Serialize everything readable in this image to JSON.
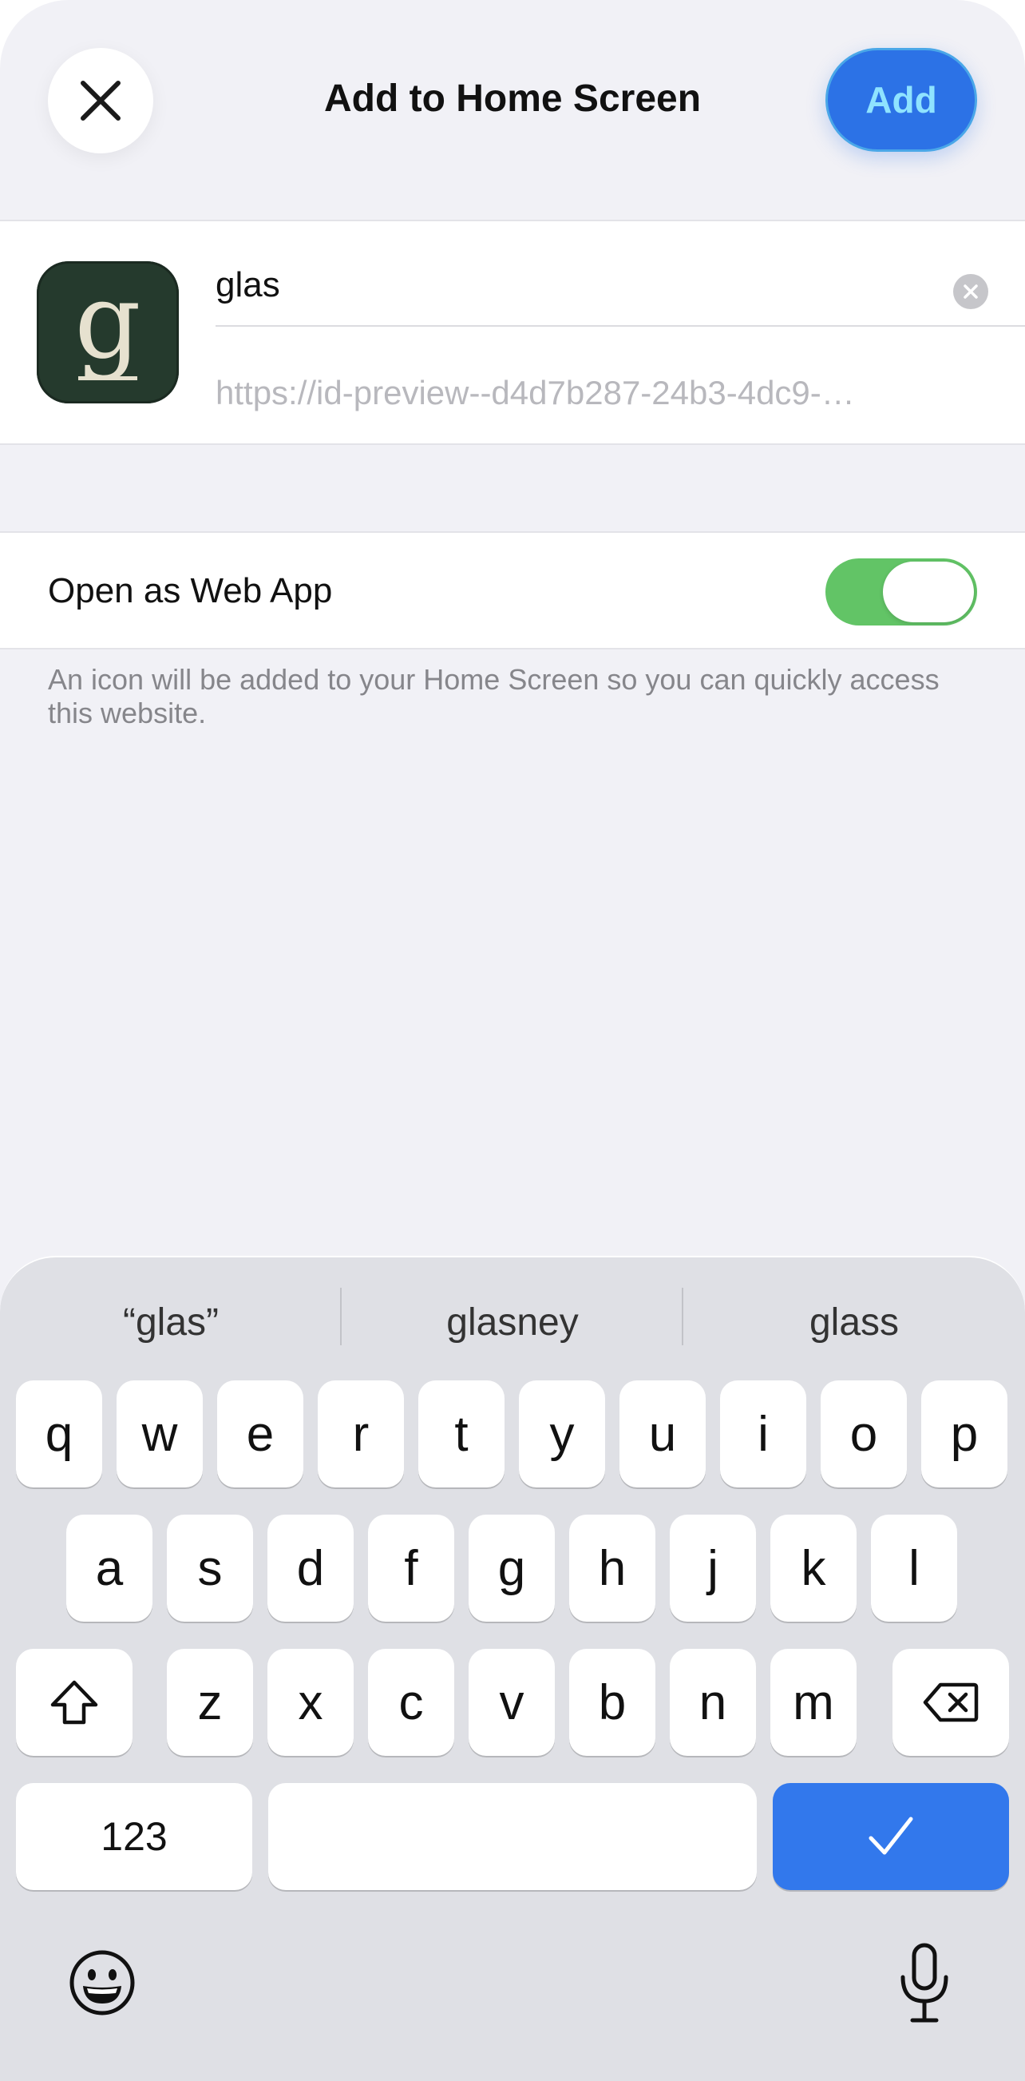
{
  "header": {
    "title": "Add to Home Screen",
    "add_label": "Add",
    "close_icon": "close-icon"
  },
  "bookmark": {
    "icon_glyph": "g",
    "name_value": "glas",
    "url_value": "https://id-preview--d4d7b287-24b3-4dc9-…"
  },
  "web_app": {
    "label": "Open as Web App",
    "enabled": true
  },
  "footnote": "An icon will be added to your Home Screen so you can quickly access this website.",
  "keyboard": {
    "suggestions": [
      "“glas”",
      "glasney",
      "glass"
    ],
    "row1": [
      "q",
      "w",
      "e",
      "r",
      "t",
      "y",
      "u",
      "i",
      "o",
      "p"
    ],
    "row2": [
      "a",
      "s",
      "d",
      "f",
      "g",
      "h",
      "j",
      "k",
      "l"
    ],
    "row3": [
      "z",
      "x",
      "c",
      "v",
      "b",
      "n",
      "m"
    ],
    "numbers_label": "123"
  },
  "colors": {
    "accent": "#2c72e6",
    "toggle_on": "#62c466",
    "background": "#f1f1f6"
  }
}
